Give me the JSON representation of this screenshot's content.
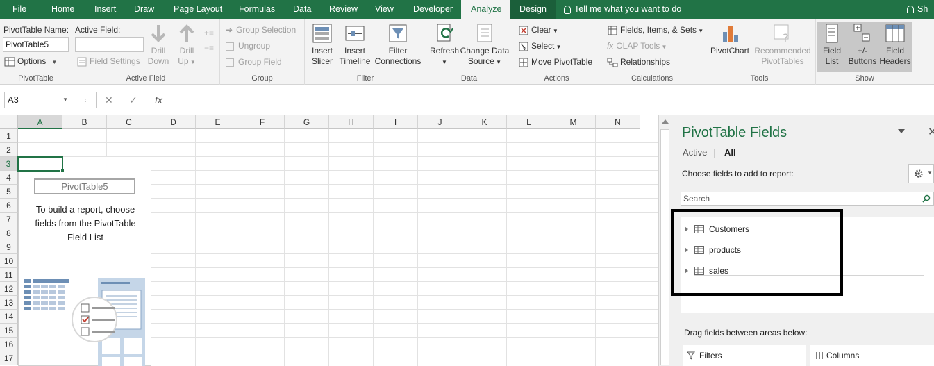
{
  "tabs": [
    {
      "label": "File"
    },
    {
      "label": "Home"
    },
    {
      "label": "Insert"
    },
    {
      "label": "Draw"
    },
    {
      "label": "Page Layout"
    },
    {
      "label": "Formulas"
    },
    {
      "label": "Data"
    },
    {
      "label": "Review"
    },
    {
      "label": "View"
    },
    {
      "label": "Developer"
    },
    {
      "label": "Analyze"
    },
    {
      "label": "Design"
    }
  ],
  "tell_me": "Tell me what you want to do",
  "user_initials": "Sh",
  "ribbon": {
    "pivottable": {
      "name_label": "PivotTable Name:",
      "name_value": "PivotTable5",
      "options": "Options",
      "group": "PivotTable"
    },
    "active_field": {
      "label": "Active Field:",
      "value": "",
      "field_settings": "Field Settings",
      "drill_down": [
        "Drill",
        "Down"
      ],
      "drill_up": [
        "Drill",
        "Up"
      ],
      "group": "Active Field"
    },
    "group_section": {
      "group_selection": "Group Selection",
      "ungroup": "Ungroup",
      "group_field": "Group Field",
      "group": "Group"
    },
    "filter": {
      "insert_slicer": [
        "Insert",
        "Slicer"
      ],
      "insert_timeline": [
        "Insert",
        "Timeline"
      ],
      "filter_connections": [
        "Filter",
        "Connections"
      ],
      "group": "Filter"
    },
    "data": {
      "refresh": "Refresh",
      "change_source": [
        "Change Data",
        "Source"
      ],
      "group": "Data"
    },
    "actions": {
      "clear": "Clear",
      "select": "Select",
      "move": "Move PivotTable",
      "group": "Actions"
    },
    "calculations": {
      "fields_items_sets": "Fields, Items, & Sets",
      "olap_tools": "OLAP Tools",
      "relationships": "Relationships",
      "group": "Calculations"
    },
    "tools": {
      "pivotchart": "PivotChart",
      "recommended": [
        "Recommended",
        "PivotTables"
      ],
      "group": "Tools"
    },
    "show": {
      "field_list": [
        "Field",
        "List"
      ],
      "buttons": [
        "+/-",
        "Buttons"
      ],
      "field_headers": [
        "Field",
        "Headers"
      ],
      "group": "Show"
    }
  },
  "formula_bar": {
    "name_box": "A3",
    "fx": "fx",
    "cancel": "✕",
    "enter": "✓",
    "value": ""
  },
  "grid": {
    "columns": [
      "A",
      "B",
      "C",
      "D",
      "E",
      "F",
      "G",
      "H",
      "I",
      "J",
      "K",
      "L",
      "M",
      "N"
    ],
    "rows": [
      "1",
      "2",
      "3",
      "4",
      "5",
      "6",
      "7",
      "8",
      "9",
      "10",
      "11",
      "12",
      "13",
      "14",
      "15",
      "16",
      "17"
    ],
    "selected_col": "A",
    "selected_row": "3"
  },
  "pivot_placeholder": {
    "title": "PivotTable5",
    "text": "To build a report, choose fields from the PivotTable Field List"
  },
  "pane": {
    "title": "PivotTable Fields",
    "tab_active": "Active",
    "tab_all": "All",
    "subtitle": "Choose fields to add to report:",
    "search_placeholder": "Search",
    "fields": [
      "Customers",
      "products",
      "sales"
    ],
    "drag_label": "Drag fields between areas below:",
    "areas": [
      "Filters",
      "Columns"
    ]
  },
  "colors": {
    "accent": "#217346",
    "highlight_border": "#000000"
  }
}
